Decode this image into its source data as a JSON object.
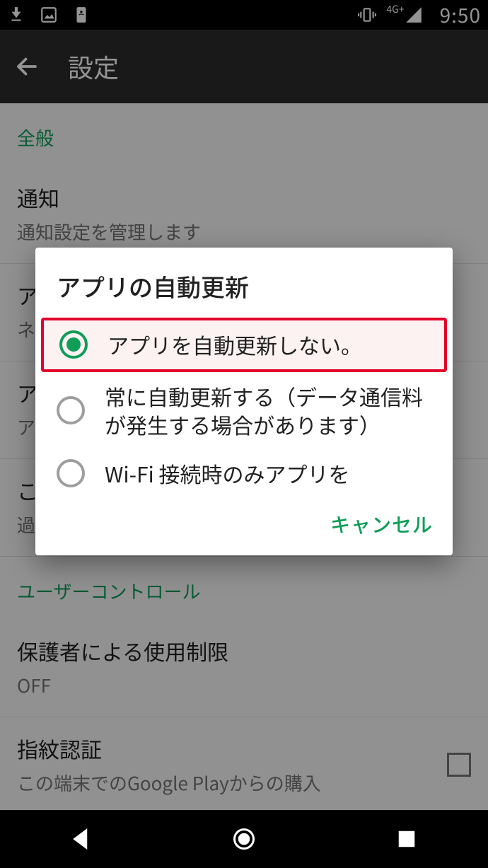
{
  "status": {
    "clock": "9:50",
    "network_label": "4G+"
  },
  "appbar": {
    "title": "設定"
  },
  "sections": {
    "general_label": "全般",
    "notification": {
      "title": "通知",
      "sub": "通知設定を管理します"
    },
    "auto_update": {
      "title": "ア",
      "sub": "ネ"
    },
    "app_detail": {
      "title": "ア",
      "sub": "ア"
    },
    "download": {
      "title": "こ",
      "sub": "過"
    },
    "user_control_label": "ユーザーコントロール",
    "parental": {
      "title": "保護者による使用制限",
      "sub": "OFF"
    },
    "fingerprint": {
      "title": "指紋認証",
      "sub": "この端末でのGoogle Playからの購入"
    }
  },
  "dialog": {
    "title": "アプリの自動更新",
    "options": [
      {
        "label": "アプリを自動更新しない。",
        "selected": true,
        "highlighted": true
      },
      {
        "label": "常に自動更新する（データ通信料が発生する場合があります）",
        "selected": false,
        "highlighted": false
      },
      {
        "label": "Wi-Fi 接続時のみアプリを",
        "selected": false,
        "highlighted": false
      }
    ],
    "cancel_label": "キャンセル"
  },
  "colors": {
    "accent": "#0f9d58",
    "highlight_border": "#e4002b"
  }
}
